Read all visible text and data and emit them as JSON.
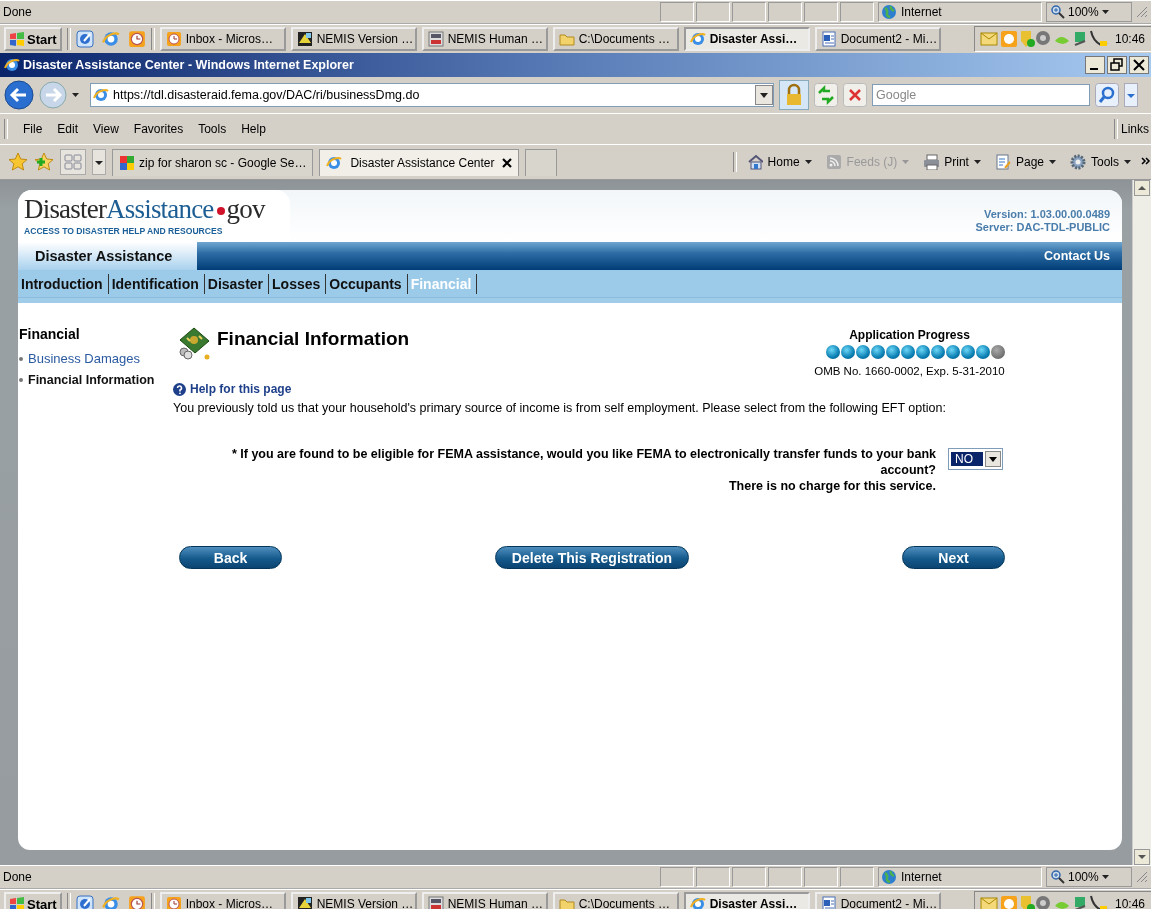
{
  "top_status_bar": {
    "text": "Done",
    "zone": "Internet",
    "zoom": "100%"
  },
  "top_taskbar": {
    "start": "Start",
    "tasks": [
      {
        "label": "Inbox - Micros…",
        "kind": "clock",
        "selected": false
      },
      {
        "label": "NEMIS Version …",
        "kind": "diagram",
        "selected": false
      },
      {
        "label": "NEMIS Human …",
        "kind": "badge",
        "selected": false
      },
      {
        "label": "C:\\Documents …",
        "kind": "folder",
        "selected": false
      },
      {
        "label": "Disaster Assi…",
        "kind": "browser",
        "selected": true
      },
      {
        "label": "Document2 - Mi…",
        "kind": "document",
        "selected": false
      }
    ],
    "clock": "10:46"
  },
  "window": {
    "title": "Disaster Assistance Center - Windows Internet Explorer"
  },
  "address_bar": {
    "url": "https://tdl.disasteraid.fema.gov/DAC/ri/businessDmg.do",
    "search_placeholder": "Google"
  },
  "menu": [
    "File",
    "Edit",
    "View",
    "Favorites",
    "Tools",
    "Help"
  ],
  "links": "Links",
  "tabs": [
    {
      "label": "zip for sharon sc - Google Se…",
      "kind": "google",
      "selected": false
    },
    {
      "label": "Disaster Assistance Center",
      "kind": "browser",
      "selected": true
    }
  ],
  "command_bar": [
    {
      "label": "Home",
      "kind": "home",
      "disabled": false
    },
    {
      "label": "Feeds (J)",
      "kind": "feeds",
      "disabled": true
    },
    {
      "label": "Print",
      "kind": "print",
      "disabled": false
    },
    {
      "label": "Page",
      "kind": "page",
      "disabled": false
    },
    {
      "label": "Tools",
      "kind": "tools",
      "disabled": false
    }
  ],
  "page": {
    "logo": {
      "parts": [
        "Disaster",
        "Assistance",
        "gov"
      ],
      "tagline": "ACCESS TO DISASTER HELP AND RESOURCES"
    },
    "version": "Version: 1.03.00.00.0489",
    "server": "Server: DAC-TDL-PUBLIC",
    "site_title": "Disaster Assistance",
    "contact": "Contact Us",
    "nav": [
      {
        "label": "Introduction",
        "selected": false
      },
      {
        "label": "Identification",
        "selected": false
      },
      {
        "label": "Disaster",
        "selected": false
      },
      {
        "label": "Losses",
        "selected": false
      },
      {
        "label": "Occupants",
        "selected": false
      },
      {
        "label": "Financial",
        "selected": true
      }
    ],
    "sidebar": {
      "heading": "Financial",
      "items": [
        {
          "label": "Business Damages",
          "selected": false
        },
        {
          "label": "Financial Information",
          "selected": true
        }
      ]
    },
    "title": "Financial Information",
    "progress": {
      "title": "Application Progress",
      "steps": [
        {
          "complete": true
        },
        {
          "complete": true
        },
        {
          "complete": true
        },
        {
          "complete": true
        },
        {
          "complete": true
        },
        {
          "complete": true
        },
        {
          "complete": true
        },
        {
          "complete": true
        },
        {
          "complete": true
        },
        {
          "complete": true
        },
        {
          "complete": true
        },
        {
          "complete": false
        }
      ],
      "omb": "OMB No. 1660-0002, Exp. 5-31-2010"
    },
    "help": "Help for this page",
    "intro": "You previously told us that your household's primary source of income is from self employment. Please select from the following EFT option:",
    "question": "* If you are found to be eligible for FEMA assistance, would you like FEMA to electronically transfer funds to your bank account?",
    "note": "There is no charge for this service.",
    "answer": {
      "value": "NO",
      "focused": true
    },
    "buttons": [
      "Back",
      "Delete This Registration",
      "Next"
    ]
  },
  "bottom_status_bar": {
    "text": "Done",
    "zone": "Internet",
    "zoom": "100%"
  },
  "bottom_taskbar": {
    "start": "Start",
    "tasks": [
      {
        "label": "Inbox - Micros…",
        "kind": "clock",
        "selected": false
      },
      {
        "label": "NEMIS Version …",
        "kind": "diagram",
        "selected": false
      },
      {
        "label": "NEMIS Human …",
        "kind": "badge",
        "selected": false
      },
      {
        "label": "C:\\Documents …",
        "kind": "folder",
        "selected": false
      },
      {
        "label": "Disaster Assi…",
        "kind": "browser",
        "selected": true
      },
      {
        "label": "Document2 - Mi…",
        "kind": "document",
        "selected": false
      }
    ],
    "clock": "10:46"
  }
}
